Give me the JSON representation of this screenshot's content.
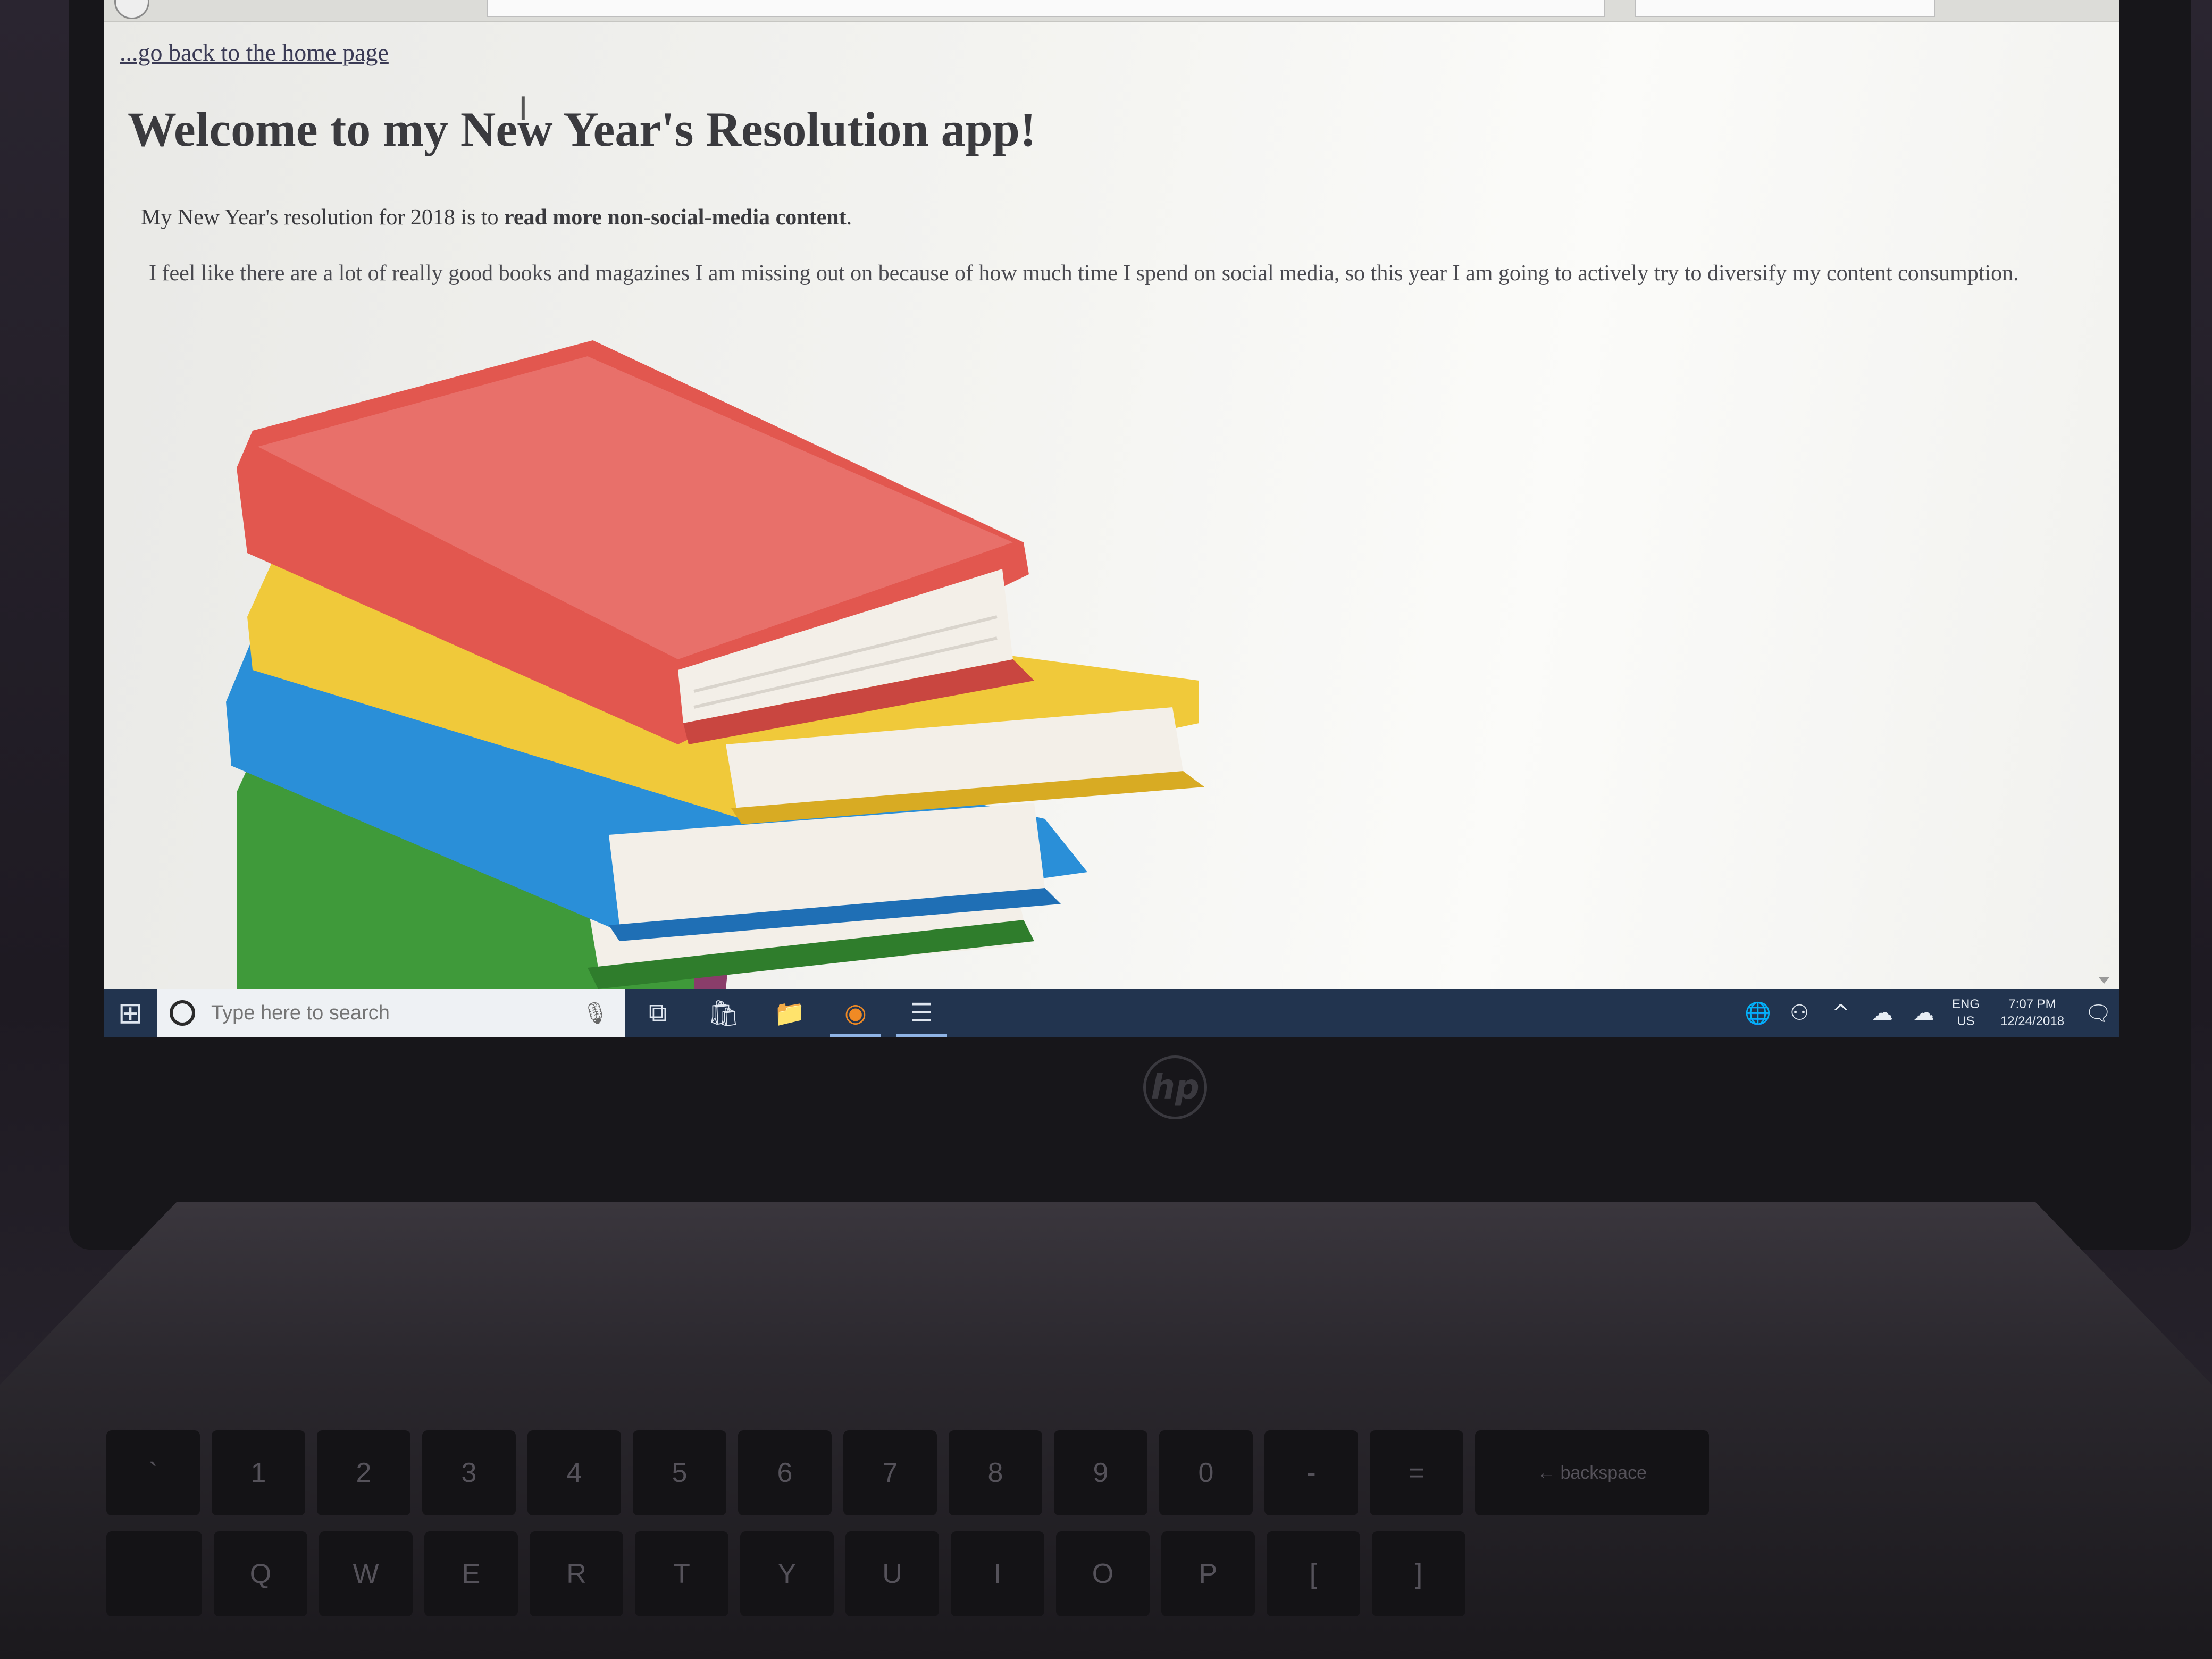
{
  "page": {
    "home_link": "...go back to the home page",
    "heading": "Welcome to my New Year's Resolution app!",
    "resolution_prefix": "My New Year's resolution for 2018 is to ",
    "resolution_bold": "read more non-social-media content",
    "resolution_suffix": ".",
    "explanation": "I feel like there are a lot of really good books and magazines I am missing out on because of how much time I spend on social media, so this year I am going to actively try to diversify my content consumption."
  },
  "taskbar": {
    "search_placeholder": "Type here to search",
    "pinned": [
      {
        "name": "task-view",
        "glyph": "⧉"
      },
      {
        "name": "store",
        "glyph": "🛍"
      },
      {
        "name": "file-explorer",
        "glyph": "📁"
      },
      {
        "name": "firefox",
        "glyph": "◉"
      },
      {
        "name": "app",
        "glyph": "☰"
      }
    ],
    "lang_top": "ENG",
    "lang_bottom": "US",
    "time": "7:07 PM",
    "date": "12/24/2018"
  },
  "colors": {
    "taskbar": "#22344f",
    "book_red": "#e2574f",
    "book_yellow": "#f0c93a",
    "book_blue": "#2a8fd8",
    "book_green": "#3f9a3a",
    "book_purple": "#8a3d6a"
  },
  "keyboard": {
    "row_numbers": [
      "`",
      "1",
      "2",
      "3",
      "4",
      "5",
      "6",
      "7",
      "8",
      "9",
      "0",
      "-",
      "=",
      "← backspace"
    ],
    "row_letters": [
      "",
      "Q",
      "W",
      "E",
      "R",
      "T",
      "Y",
      "U",
      "I",
      "O",
      "P",
      "[",
      "]"
    ]
  }
}
